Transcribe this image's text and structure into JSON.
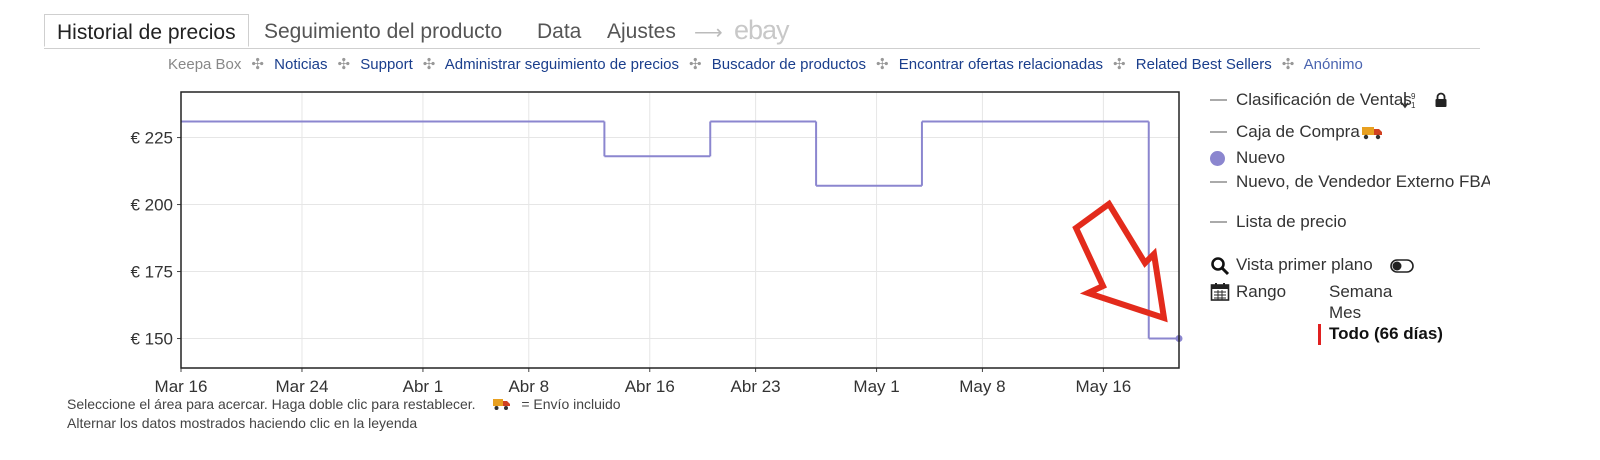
{
  "tabs": {
    "items": [
      "Historial de precios",
      "Seguimiento del producto",
      "Data",
      "Ajustes"
    ],
    "arrow": "⟶",
    "ebay": "ebay"
  },
  "links": {
    "items": [
      "Keepa Box",
      "Noticias",
      "Support",
      "Administrar seguimiento de precios",
      "Buscador de productos",
      "Encontrar ofertas relacionadas",
      "Related Best Sellers",
      "Anónimo"
    ]
  },
  "legend": {
    "clasificacion": "Clasificación de Ventas",
    "caja": "Caja de Compra",
    "nuevo": "Nuevo",
    "externo": "Nuevo, de Vendedor Externo FBA",
    "lista": "Lista de precio",
    "vista": "Vista primer plano",
    "rango": "Rango",
    "range_options": [
      "Semana",
      "Mes",
      "Todo (66 días)"
    ],
    "selected_range": "Todo (66 días)"
  },
  "footer": {
    "line1_a": "Seleccione el área para acercar. Haga doble clic para restablecer.",
    "line1_b": "= Envío incluido",
    "line2": "Alternar los datos mostrados haciendo clic en la leyenda"
  },
  "colors": {
    "series": "#8b86cf",
    "arrow": "#e32b1c",
    "link": "#1a3e8c",
    "selected_bar": "#e02020"
  },
  "chart_data": {
    "type": "line",
    "step": true,
    "x_ticks": [
      "Mar 16",
      "Mar 24",
      "Abr 1",
      "Abr 8",
      "Abr 16",
      "Abr 23",
      "May 1",
      "May 8",
      "May 16"
    ],
    "y_ticks": [
      "€ 225",
      "€ 200",
      "€ 175",
      "€ 150"
    ],
    "ylim": [
      139,
      242
    ],
    "x_range": [
      "2024-03-16",
      "2024-05-21"
    ],
    "grid": true,
    "series": [
      {
        "name": "Nuevo",
        "points": [
          {
            "x": "2024-03-16",
            "y": 231
          },
          {
            "x": "2024-04-13",
            "y": 231
          },
          {
            "x": "2024-04-13",
            "y": 218
          },
          {
            "x": "2024-04-20",
            "y": 218
          },
          {
            "x": "2024-04-20",
            "y": 231
          },
          {
            "x": "2024-04-27",
            "y": 231
          },
          {
            "x": "2024-04-27",
            "y": 207
          },
          {
            "x": "2024-05-04",
            "y": 207
          },
          {
            "x": "2024-05-04",
            "y": 231
          },
          {
            "x": "2024-05-19",
            "y": 231
          },
          {
            "x": "2024-05-19",
            "y": 189
          },
          {
            "x": "2024-05-19",
            "y": 150
          },
          {
            "x": "2024-05-21",
            "y": 150
          }
        ]
      }
    ]
  }
}
